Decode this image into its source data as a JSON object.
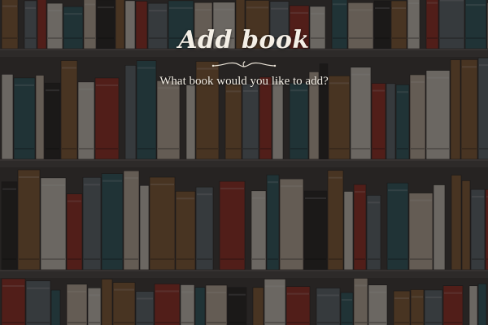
{
  "page": {
    "title": "Add book",
    "subtitle": "What book would you like to add?"
  },
  "background": {
    "image": "bookshelf-background",
    "palette": {
      "shelf": "#4a4543",
      "shelf_edge": "#5c5654",
      "red": "#9c2b22",
      "brown": "#8a5d36",
      "tan": "#c7b9a6",
      "slate": "#5f6a72",
      "teal": "#2e5b63",
      "cream": "#d8d2c6",
      "dark": "#242120"
    }
  }
}
